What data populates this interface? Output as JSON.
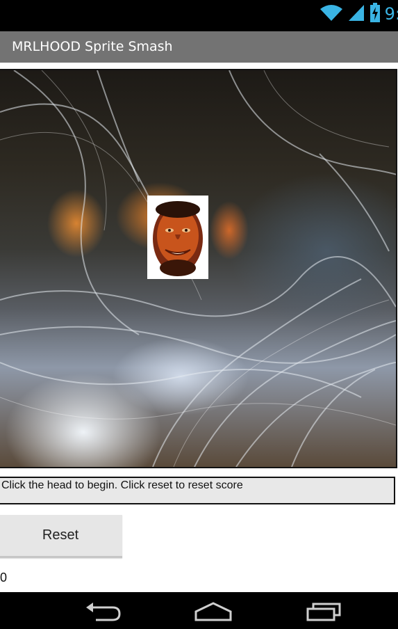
{
  "status_bar": {
    "time": "9:",
    "icons": [
      "wifi-icon",
      "signal-icon",
      "battery-charging-icon"
    ],
    "accent_color": "#3ab4e4"
  },
  "app": {
    "title": "MRLHOOD Sprite Smash",
    "title_bar_color": "#737373"
  },
  "canvas": {
    "background_description_icon": "glass-swirl-background",
    "sprite_icon": "face-sprite"
  },
  "instruction": {
    "text": "Click the head to begin. Click reset to reset score"
  },
  "controls": {
    "reset_label": "Reset"
  },
  "score": {
    "value": "0"
  },
  "nav_bar": {
    "icons": [
      "back-icon",
      "home-icon",
      "recents-icon"
    ]
  }
}
